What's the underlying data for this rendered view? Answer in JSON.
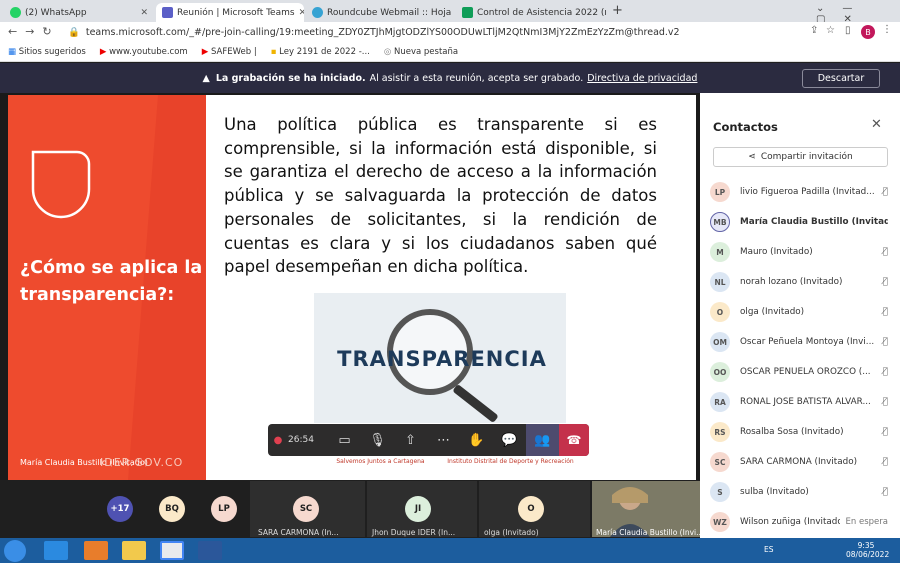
{
  "browser": {
    "tabs": [
      {
        "label": "(2) WhatsApp",
        "color": "#25d366"
      },
      {
        "label": "Reunión | Microsoft Teams",
        "color": "#5b5fc7"
      },
      {
        "label": "Roundcube Webmail :: Hoja de c",
        "color": "#37a3d3"
      },
      {
        "label": "Control de Asistencia 2022 (resp",
        "color": "#0f9d58"
      }
    ],
    "url": "teams.microsoft.com/_#/pre-join-calling/19:meeting_ZDY0ZTJhMjgtODZlYS00ODUwLTljM2QtNmI3MjY2ZmEzYzZm@thread.v2",
    "profile": "B",
    "bookmarks": [
      "Sitios sugeridos",
      "www.youtube.com",
      "SAFEWeb |",
      "Ley 2191 de 2022 -...",
      "Nueva pestaña"
    ]
  },
  "banner": {
    "bold": "La grabación se ha iniciado.",
    "text": "Al asistir a esta reunión, acepta ser grabado.",
    "link": "Directiva de privacidad",
    "button": "Descartar"
  },
  "slide": {
    "title": "¿Cómo se aplica la transparencia?:",
    "body": "Una política pública es transparente si es comprensible, si la información está disponible, si se garantiza el derecho de acceso a la información pública y se salvaguarda la protección de datos personales de solicitantes, si la rendición de cuentas es clara y si los ciudadanos saben qué papel desempeñan en dicha política.",
    "image_word": "TRANSPARENCIA",
    "presenter": "María Claudia Bustillo (Invitado)",
    "website": "IDER.GOV.CO",
    "logo1": "Salvemos Juntos a Cartagena",
    "logo2": "Instituto Distrital de Deporte y Recreación"
  },
  "controls": {
    "timer": "26:54"
  },
  "panel": {
    "title": "Contactos",
    "share": "Compartir invitación",
    "participants": [
      {
        "initials": "LP",
        "name": "livio Figueroa Padilla (Invitad...",
        "color": "#f6d9cf",
        "bold": false
      },
      {
        "initials": "MB",
        "name": "María Claudia Bustillo (Invitado)",
        "color": "#e6e8f8",
        "bold": true
      },
      {
        "initials": "M",
        "name": "Mauro (Invitado)",
        "color": "#dcefdc",
        "bold": false
      },
      {
        "initials": "NL",
        "name": "norah lozano (Invitado)",
        "color": "#dbe6f3",
        "bold": false
      },
      {
        "initials": "O",
        "name": "olga (Invitado)",
        "color": "#fbe9c9",
        "bold": false
      },
      {
        "initials": "OM",
        "name": "Oscar Peñuela Montoya (Invi...",
        "color": "#dbe6f3",
        "bold": false
      },
      {
        "initials": "OO",
        "name": "OSCAR PEÑUELA OROZCO (...",
        "color": "#dcefdc",
        "bold": false
      },
      {
        "initials": "RA",
        "name": "RONAL JOSE BATISTA ALVAR...",
        "color": "#dbe6f3",
        "bold": false
      },
      {
        "initials": "RS",
        "name": "Rosalba Sosa (Invitado)",
        "color": "#fbe9c9",
        "bold": false
      },
      {
        "initials": "SC",
        "name": "SARA CARMONA (Invitado)",
        "color": "#f6d9cf",
        "bold": false
      },
      {
        "initials": "S",
        "name": "sulba (Invitado)",
        "color": "#dbe6f3",
        "bold": false
      },
      {
        "initials": "WZ",
        "name": "Wilson zuñiga (Invitado)",
        "color": "#f6d9cf",
        "bold": false,
        "status": "En espera"
      }
    ]
  },
  "strip": {
    "more": "+17",
    "avatars": [
      {
        "initials": "BQ",
        "color": "#fbe9c9"
      },
      {
        "initials": "LP",
        "color": "#f6d9cf"
      }
    ],
    "tiles": [
      {
        "initials": "SC",
        "label": "SARA CARMONA (In...",
        "color": "#f6d9cf"
      },
      {
        "initials": "JI",
        "label": "Jhon Duque IDER (In...",
        "color": "#dcefdc"
      },
      {
        "initials": "O",
        "label": "olga (Invitado)",
        "color": "#fbe9c9"
      }
    ],
    "video_label": "María Claudia Bustillo (Invi..."
  },
  "taskbar": {
    "lang": "ES",
    "time": "9:35",
    "date": "08/06/2022"
  }
}
